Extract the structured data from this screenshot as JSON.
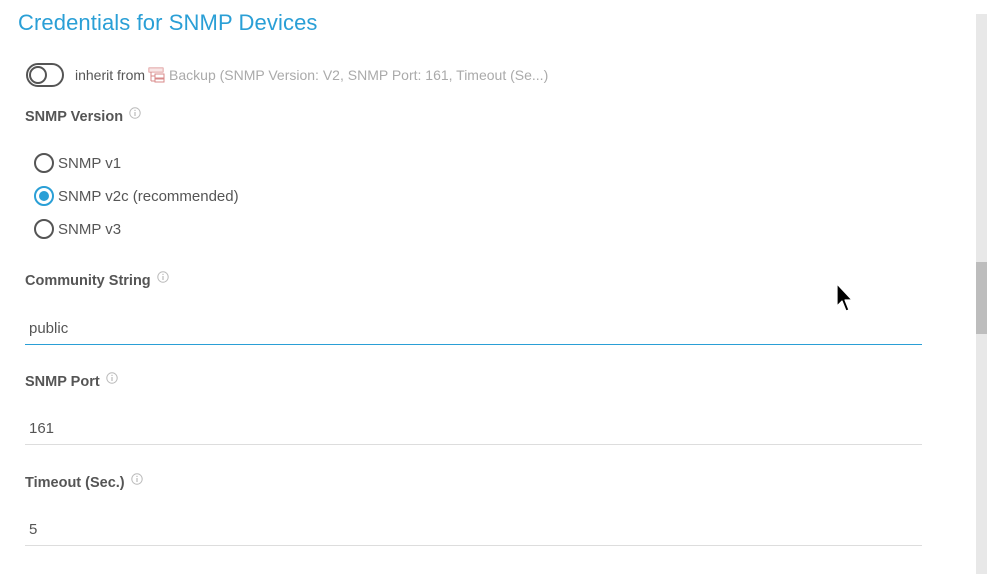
{
  "title": "Credentials for SNMP Devices",
  "inherit": {
    "label": "inherit from",
    "source": "Backup (SNMP Version: V2, SNMP Port: 161, Timeout (Se...)",
    "enabled": false
  },
  "snmp_version": {
    "label": "SNMP Version",
    "options": [
      {
        "label": "SNMP v1",
        "checked": false
      },
      {
        "label": "SNMP v2c (recommended)",
        "checked": true
      },
      {
        "label": "SNMP v3",
        "checked": false
      }
    ]
  },
  "community_string": {
    "label": "Community String",
    "value": "public"
  },
  "snmp_port": {
    "label": "SNMP Port",
    "value": "161"
  },
  "timeout": {
    "label": "Timeout (Sec.)",
    "value": "5"
  },
  "colors": {
    "accent": "#2a9fd6",
    "text": "#555555",
    "muted": "#aaaaaa"
  }
}
